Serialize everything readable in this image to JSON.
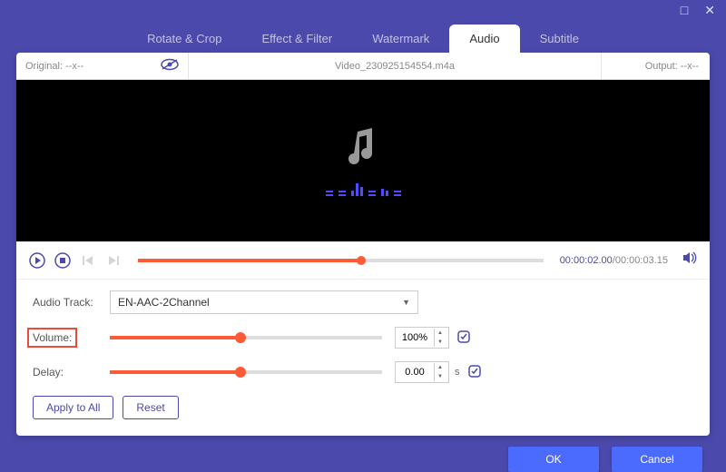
{
  "window": {
    "minimize": "—",
    "maximize": "□",
    "close": "✕"
  },
  "tabs": {
    "rotate": "Rotate & Crop",
    "effect": "Effect & Filter",
    "watermark": "Watermark",
    "audio": "Audio",
    "subtitle": "Subtitle"
  },
  "filebar": {
    "original_label": "Original:  --x--",
    "filename": "Video_230925154554.m4a",
    "output_label": "Output:  --x--"
  },
  "player": {
    "current": "00:00:02.00",
    "sep": "/",
    "duration": "00:00:03.15"
  },
  "controls": {
    "track_label": "Audio Track:",
    "track_value": "EN-AAC-2Channel",
    "volume_label": "Volume:",
    "volume_value": "100%",
    "delay_label": "Delay:",
    "delay_value": "0.00",
    "delay_unit": "s",
    "apply_all": "Apply to All",
    "reset": "Reset"
  },
  "footer": {
    "ok": "OK",
    "cancel": "Cancel"
  }
}
